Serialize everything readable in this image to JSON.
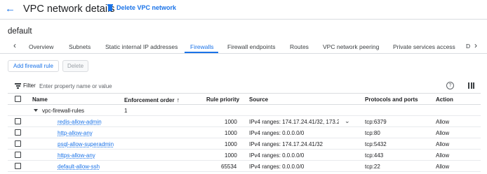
{
  "header": {
    "title": "VPC network details",
    "delete_label": "Delete VPC network"
  },
  "network": {
    "name": "default"
  },
  "tabs": [
    {
      "label": "Overview"
    },
    {
      "label": "Subnets"
    },
    {
      "label": "Static internal IP addresses"
    },
    {
      "label": "Firewalls",
      "active": true
    },
    {
      "label": "Firewall endpoints"
    },
    {
      "label": "Routes"
    },
    {
      "label": "VPC network peering"
    },
    {
      "label": "Private services access"
    },
    {
      "label": "D"
    }
  ],
  "actions": {
    "add_label": "Add firewall rule",
    "delete_label": "Delete"
  },
  "filter": {
    "label": "Filter",
    "placeholder": "Enter property name or value"
  },
  "table": {
    "columns": {
      "name": "Name",
      "enforcement": "Enforcement order",
      "priority": "Rule priority",
      "source": "Source",
      "protocols": "Protocols and ports",
      "action": "Action"
    },
    "group": {
      "name": "vpc-firewall-rules",
      "order": "1"
    },
    "rows": [
      {
        "name": "redis-allow-admin",
        "priority": "1000",
        "source": "IPv4 ranges: 174.17.24.41/32, 173.2",
        "protocols": "tcp:6379",
        "action": "Allow"
      },
      {
        "name": "http-allow-any",
        "priority": "1000",
        "source": "IPv4 ranges: 0.0.0.0/0",
        "protocols": "tcp:80",
        "action": "Allow"
      },
      {
        "name": "psql-allow-superadmin",
        "priority": "1000",
        "source": "IPv4 ranges: 174.17.24.41/32",
        "protocols": "tcp:5432",
        "action": "Allow"
      },
      {
        "name": "https-allow-any",
        "priority": "1000",
        "source": "IPv4 ranges: 0.0.0.0/0",
        "protocols": "tcp:443",
        "action": "Allow"
      },
      {
        "name": "default-allow-ssh",
        "priority": "65534",
        "source": "IPv4 ranges: 0.0.0.0/0",
        "protocols": "tcp:22",
        "action": "Allow"
      }
    ]
  },
  "colors": {
    "accent": "#1a73e8",
    "text": "#202124",
    "border": "#dadce0"
  }
}
